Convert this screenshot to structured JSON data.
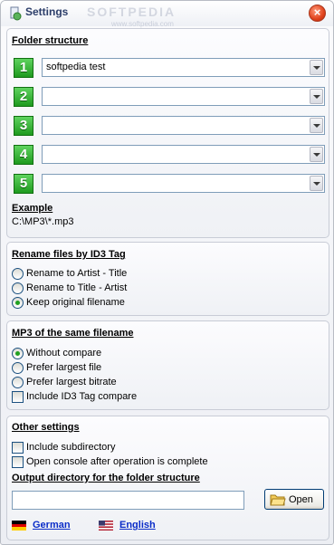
{
  "window": {
    "title": "Settings",
    "watermark": "SOFTPEDIA",
    "watermark_sub": "www.softpedia.com"
  },
  "folder_structure": {
    "title": "Folder structure",
    "slots": [
      {
        "number": "1",
        "value": "softpedia test"
      },
      {
        "number": "2",
        "value": ""
      },
      {
        "number": "3",
        "value": ""
      },
      {
        "number": "4",
        "value": ""
      },
      {
        "number": "5",
        "value": ""
      }
    ],
    "example_label": "Example",
    "example_value": "C:\\MP3\\*.mp3"
  },
  "rename": {
    "title": "Rename files by ID3 Tag",
    "options": [
      {
        "label": "Rename to Artist - Title",
        "checked": false
      },
      {
        "label": "Rename to Title - Artist",
        "checked": false
      },
      {
        "label": "Keep original filename",
        "checked": true
      }
    ]
  },
  "same_filename": {
    "title": "MP3 of the same filename",
    "options": [
      {
        "label": "Without compare",
        "checked": true
      },
      {
        "label": "Prefer largest file",
        "checked": false
      },
      {
        "label": "Prefer largest bitrate",
        "checked": false
      }
    ],
    "include_id3_label": "Include ID3 Tag compare"
  },
  "other": {
    "title": "Other settings",
    "include_subdir_label": "Include subdirectory",
    "open_console_label": "Open console after operation is complete",
    "output_title": "Output directory for the folder structure",
    "output_value": "",
    "open_button": "Open"
  },
  "languages": {
    "german": "German",
    "english": "English"
  },
  "colors": {
    "accent_green": "#1e9a1e",
    "link_blue": "#0a2cc8",
    "close_red": "#e0431c"
  }
}
